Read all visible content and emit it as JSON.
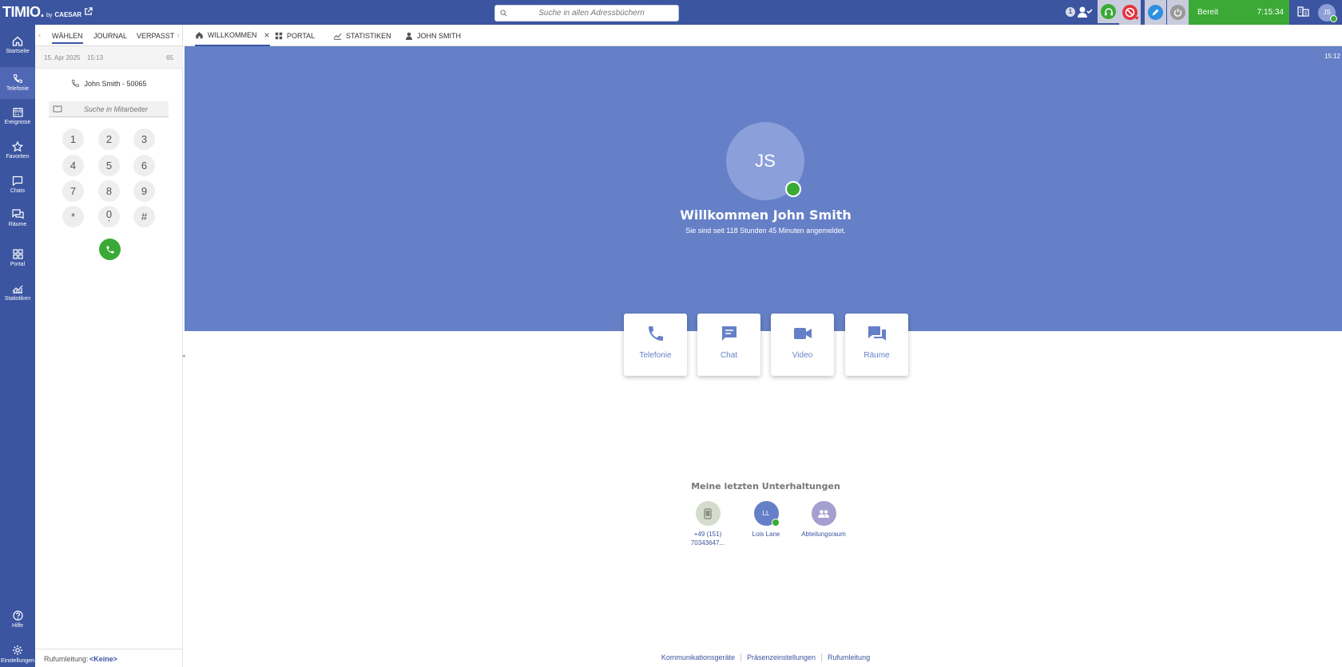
{
  "app": {
    "logo": "TIMIO.",
    "by": "by",
    "brand": "CAESAR"
  },
  "topbar": {
    "search_placeholder": "Suche in allen Adressbüchern",
    "presence_count": "1",
    "status_label": "Bereit",
    "status_time": "7:15:34",
    "avatar_initials": "JS",
    "status_color": "#3aa935"
  },
  "leftnav": {
    "items": [
      {
        "label": "Startseite",
        "icon": "home-icon"
      },
      {
        "label": "Telefonie",
        "icon": "phone-icon"
      },
      {
        "label": "Ereignisse",
        "icon": "calendar-icon"
      },
      {
        "label": "Favoriten",
        "icon": "star-icon"
      },
      {
        "label": "Chats",
        "icon": "chat-icon"
      },
      {
        "label": "Räume",
        "icon": "rooms-icon"
      },
      {
        "label": "Portal",
        "icon": "grid-icon"
      },
      {
        "label": "Statistiken",
        "icon": "chart-icon"
      }
    ],
    "help_label": "Hilfe",
    "settings_label": "Einstellungen"
  },
  "dialpanel": {
    "tabs": [
      "WÄHLEN",
      "JOURNAL",
      "VERPASST"
    ],
    "date": "15. Apr 2025",
    "time": "15:13",
    "count": "65",
    "caller": "John Smith - 50065",
    "search_placeholder": "Suche in Mitarbeiter",
    "keys": [
      "1",
      "2",
      "3",
      "4",
      "5",
      "6",
      "7",
      "8",
      "9",
      "*",
      "0",
      "#"
    ],
    "zero_sub": "+",
    "forwarding_label": "Rufumleitung:",
    "forwarding_value": "<Keine>"
  },
  "content_tabs": [
    "WILLKOMMEN",
    "PORTAL",
    "STATISTIKEN",
    "JOHN SMITH"
  ],
  "hero": {
    "time": "15:12",
    "avatar_initials": "JS",
    "welcome": "Willkommen John Smith",
    "login_info": "Sie sind seit 118 Stunden 45 Minuten angemeldet.",
    "hero_color": "#6580c6"
  },
  "quick_actions": [
    "Telefonie",
    "Chat",
    "Video",
    "Räume"
  ],
  "recent": {
    "title": "Meine letzten Unterhaltungen",
    "items": [
      {
        "label": "+49 (151) 70343647...",
        "initials": "",
        "icon": "mobile-icon"
      },
      {
        "label": "Lois Lane",
        "initials": "LL"
      },
      {
        "label": "Abteilungsraum",
        "initials": "",
        "icon": "group-icon"
      }
    ]
  },
  "footer": {
    "links": [
      "Kommunikationsgeräte",
      "Präsenzeinstellungen",
      "Rufumleitung"
    ]
  }
}
